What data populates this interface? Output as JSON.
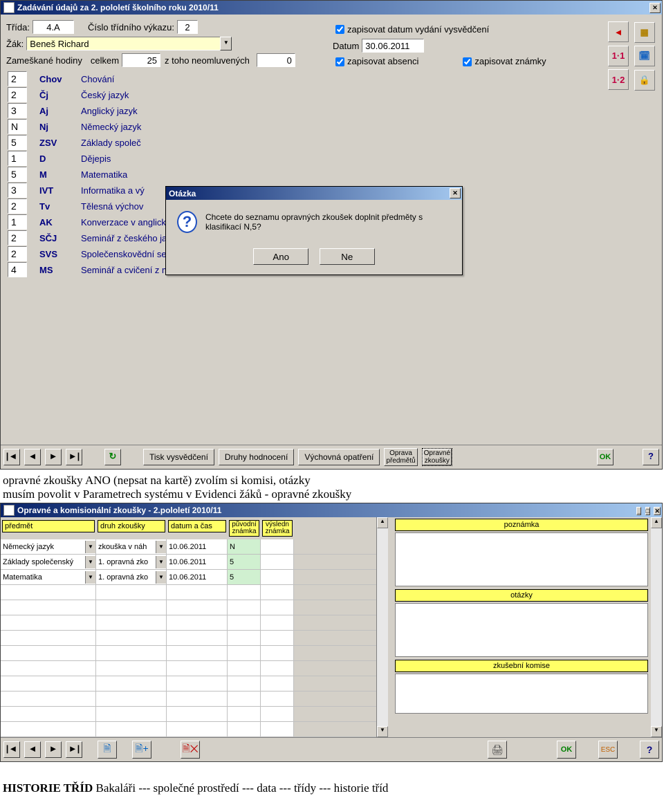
{
  "win1": {
    "title": "Zadávání údajů za 2. pololetí školního roku 2010/11",
    "trida_lbl": "Třída:",
    "trida_val": "4.A",
    "vykaz_lbl": "Číslo třídního výkazu:",
    "vykaz_val": "2",
    "zak_lbl": "Žák:",
    "zak_val": "Beneš Richard",
    "zam_lbl": "Zameškané hodiny",
    "celkem_lbl": "celkem",
    "celkem_val": "25",
    "neoml_lbl": "z toho neomluvených",
    "neoml_val": "0",
    "chk1": "zapisovat datum vydání vysvědčení",
    "datum_lbl": "Datum",
    "datum_val": "30.06.2011",
    "chk2": "zapisovat absenci",
    "chk3": "zapisovat známky",
    "side_11": "1·1",
    "side_12": "1·2",
    "subjects": [
      {
        "g": "2",
        "c": "Chov",
        "n": "Chování"
      },
      {
        "g": "2",
        "c": "Čj",
        "n": "Český jazyk"
      },
      {
        "g": "3",
        "c": "Aj",
        "n": "Anglický jazyk"
      },
      {
        "g": "N",
        "c": "Nj",
        "n": "Německý jazyk"
      },
      {
        "g": "5",
        "c": "ZSV",
        "n": "Základy společ"
      },
      {
        "g": "1",
        "c": "D",
        "n": "Dějepis"
      },
      {
        "g": "5",
        "c": "M",
        "n": "Matematika"
      },
      {
        "g": "3",
        "c": "IVT",
        "n": "Informatika a vý"
      },
      {
        "g": "2",
        "c": "Tv",
        "n": "Tělesná výchov"
      },
      {
        "g": "1",
        "c": "AK",
        "n": "Konverzace v anglickém jazyce"
      },
      {
        "g": "2",
        "c": "SČJ",
        "n": "Seminář z českého jazyka"
      },
      {
        "g": "2",
        "c": "SVS",
        "n": "Společenskovědní seminář"
      },
      {
        "g": "4",
        "c": "MS",
        "n": "Seminář a cvičení z matematiky"
      }
    ],
    "footer": {
      "tisk": "Tisk vysvědčení",
      "druhy": "Druhy hodnocení",
      "vychov": "Výchovná opatření",
      "oprava": "Oprava\npředmětů",
      "opravne": "Opravné\nzkoušky",
      "ok": "OK",
      "help": "?"
    }
  },
  "dialog": {
    "title": "Otázka",
    "msg": "Chcete do seznamu opravných zkoušek doplnit předměty s klasifikací N,5?",
    "yes": "Ano",
    "no": "Ne"
  },
  "between": "opravné zkoušky ANO (nepsat na kartě) zvolím si komisi, otázky\nmusím povolit v Parametrech systému v Evidenci žáků - opravné zkoušky",
  "win2": {
    "title": "Opravné a komisionální zkoušky - 2.pololetí 2010/11",
    "hdr": {
      "predmet": "předmět",
      "druh": "druh zkoušky",
      "datum": "datum a čas",
      "puvodni": "původní\nznámka",
      "vysledn": "výsledn\nznámka",
      "poznamka": "poznámka",
      "otazky": "otázky",
      "komise": "zkušební komise"
    },
    "rows": [
      {
        "p": "Německý jazyk",
        "d": "zkouška v náh",
        "t": "10.06.2011",
        "pu": "N",
        "vy": ""
      },
      {
        "p": "Základy společenský",
        "d": "1. opravná zko",
        "t": "10.06.2011",
        "pu": "5",
        "vy": ""
      },
      {
        "p": "Matematika",
        "d": "1. opravná zko",
        "t": "10.06.2011",
        "pu": "5",
        "vy": ""
      }
    ]
  },
  "bottom_bold": "HISTORIE TŘÍD",
  "bottom_rest": " Bakaláři --- společné prostředí --- data --- třídy --- historie tříd"
}
